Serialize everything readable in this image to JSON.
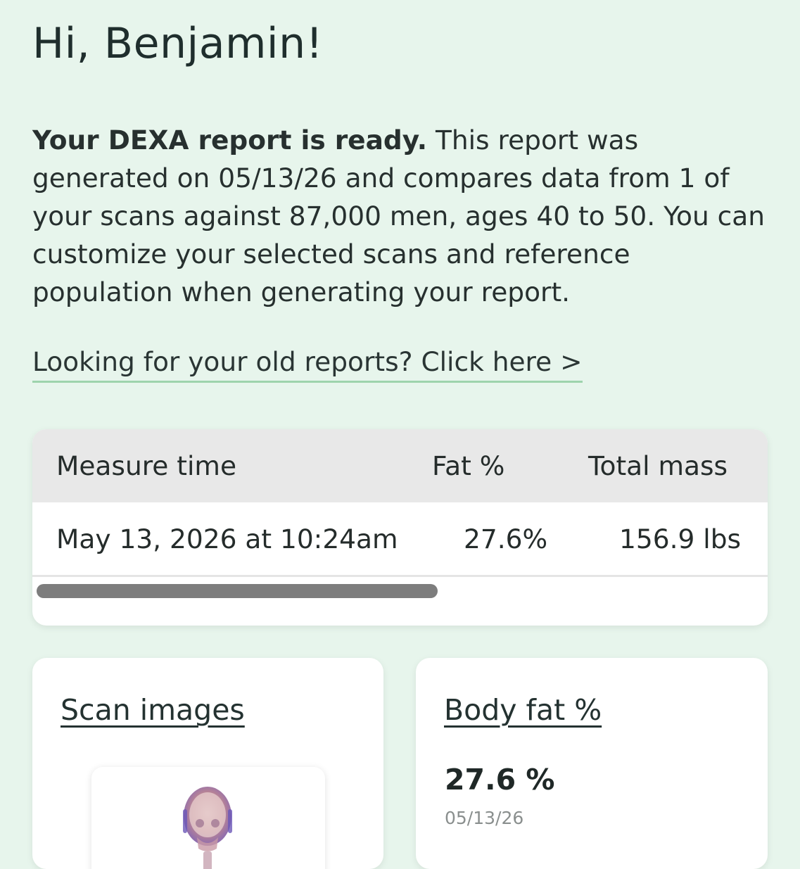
{
  "greeting": "Hi, Benjamin!",
  "intro": {
    "lead": "Your DEXA report is ready.",
    "body": " This report was generated on 05/13/26 and compares data from 1 of your scans against 87,000 men, ages 40 to 50. You can customize your selected scans and reference population when generating your report."
  },
  "old_reports_link": "Looking for your old reports? Click here >",
  "scans_table": {
    "headers": [
      "Measure time",
      "Fat %",
      "Total mass"
    ],
    "rows": [
      [
        "May 13, 2026 at 10:24am",
        "27.6%",
        "156.9 lbs"
      ]
    ]
  },
  "scan_images": {
    "title": "Scan images",
    "icon": "dexa-skeleton-scan-thumbnail"
  },
  "body_fat": {
    "title": "Body fat %",
    "value": "27.6 %",
    "date": "05/13/26"
  },
  "colors": {
    "background": "#e7f5ec",
    "link_underline": "#9ed4ad",
    "table_header": "#e8e8e8",
    "scrollbar": "#7d7d7d"
  }
}
